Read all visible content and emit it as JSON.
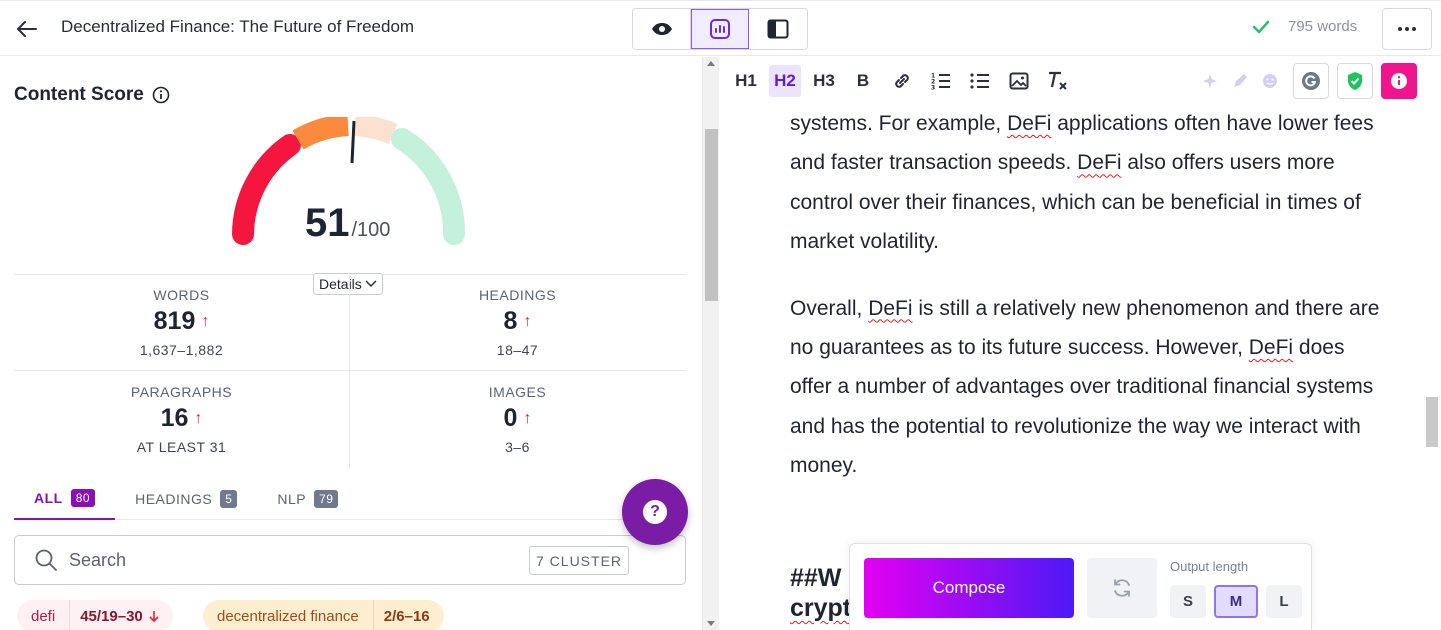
{
  "header": {
    "title": "Decentralized Finance: The Future of Freedom",
    "word_count": "795 words"
  },
  "content_score": {
    "title": "Content Score",
    "score": "51",
    "max": "/100",
    "details_label": "Details",
    "gauge_level": 0.51
  },
  "stats": {
    "words": {
      "label": "WORDS",
      "value": "819",
      "range": "1,637–1,882"
    },
    "headings": {
      "label": "HEADINGS",
      "value": "8",
      "range": "18–47"
    },
    "paragraphs": {
      "label": "PARAGRAPHS",
      "value": "16",
      "range": "AT LEAST 31"
    },
    "images": {
      "label": "IMAGES",
      "value": "0",
      "range": "3–6"
    }
  },
  "tabs": [
    {
      "label": "ALL",
      "count": "80"
    },
    {
      "label": "HEADINGS",
      "count": "5"
    },
    {
      "label": "NLP",
      "count": "79"
    }
  ],
  "search": {
    "placeholder": "Search",
    "cluster_label": "7 CLUSTER"
  },
  "terms": [
    {
      "name": "defi",
      "count": "45/19–30"
    },
    {
      "name": "decentralized finance",
      "count": "2/6–16"
    }
  ],
  "toolbar": {
    "h1": "H1",
    "h2": "H2",
    "h3": "H3",
    "bold": "B"
  },
  "editor": {
    "p1": {
      "a": "systems. For example, ",
      "b": "DeFi",
      "c": " applications often have lower fees and faster transaction speeds. ",
      "d": "DeFi",
      "e": " also offers users more control over their finances, which can be beneficial in times of market volatility."
    },
    "p2": {
      "a": "Overall, ",
      "b": "DeFi",
      "c": " is still a relatively new phenomenon and there are no guarantees as to its future success. However, ",
      "d": "DeFi",
      "e": " does offer a number of advantages over traditional financial systems and has the potential to revolutionize the way we interact with money."
    },
    "heading_line1": "##W",
    "heading_line2": "crypt"
  },
  "compose": {
    "button": "Compose",
    "output_label": "Output length",
    "sizes": [
      "S",
      "M",
      "L"
    ],
    "selected": "M"
  },
  "colors": {
    "accent": "#8a0fb6",
    "gauge_red": "#f5163f",
    "gauge_orange": "#fb8a3c",
    "gauge_peach": "#fde1cf",
    "gauge_green": "#c3f1dc",
    "compose_start": "#e400f2",
    "compose_end": "#4d19f5",
    "check_green": "#25c16f"
  }
}
